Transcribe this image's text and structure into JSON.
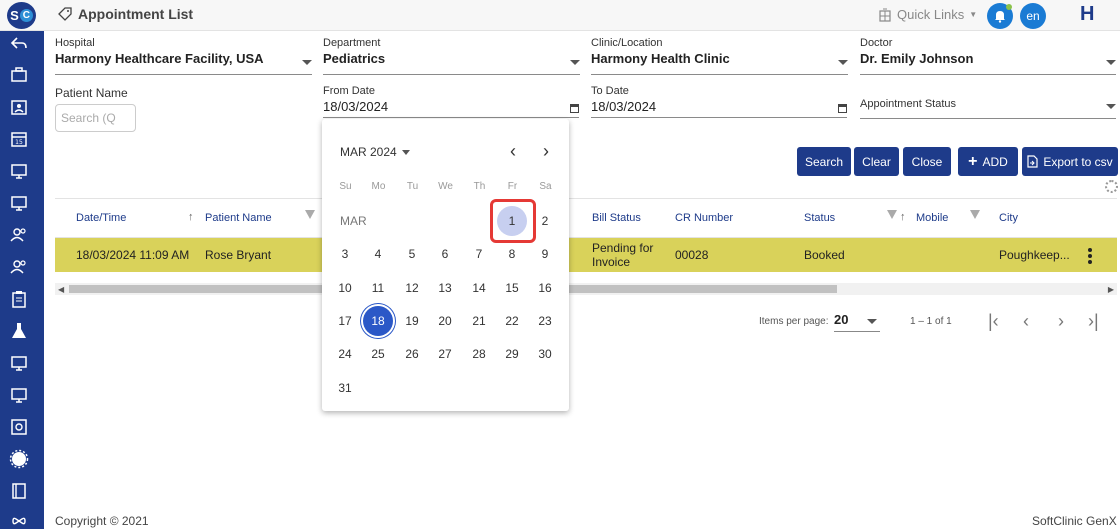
{
  "header": {
    "title": "Appointment List",
    "quick_links": "Quick Links",
    "lang": "en",
    "badge": "H",
    "logo_s": "S",
    "logo_c": "C"
  },
  "sidebar": {
    "icons": [
      "back-arrow-icon",
      "briefcase-icon",
      "id-card-icon",
      "calendar-icon",
      "monitor-icon",
      "monitor-icon",
      "users-icon",
      "users-icon",
      "clipboard-icon",
      "flask-icon",
      "monitor-icon",
      "monitor-icon",
      "safe-icon",
      "badge-icon",
      "book-icon",
      "infinity-icon"
    ]
  },
  "filters": {
    "hospital": {
      "label": "Hospital",
      "value": "Harmony Healthcare Facility, USA"
    },
    "department": {
      "label": "Department",
      "value": "Pediatrics"
    },
    "clinic": {
      "label": "Clinic/Location",
      "value": "Harmony Health Clinic"
    },
    "doctor": {
      "label": "Doctor",
      "value": "Dr. Emily Johnson"
    },
    "patient_name": {
      "label": "Patient Name",
      "placeholder": "Search (Q"
    },
    "from_date": {
      "label": "From Date",
      "value": "18/03/2024"
    },
    "to_date": {
      "label": "To Date",
      "value": "18/03/2024"
    },
    "appointment_status": {
      "label": "Appointment Status"
    }
  },
  "buttons": {
    "search": "Search",
    "clear": "Clear",
    "close": "Close",
    "add": "ADD",
    "export": "Export to csv"
  },
  "table": {
    "columns": [
      "Date/Time",
      "Patient Name",
      "Bill Status",
      "CR Number",
      "Status",
      "Mobile",
      "City"
    ],
    "rows": [
      {
        "datetime": "18/03/2024 11:09 AM",
        "patient": "Rose Bryant",
        "bill_line1": "Pending for",
        "bill_line2": "Invoice",
        "cr": "00028",
        "status": "Booked",
        "mobile": "",
        "city": "Poughkeep..."
      }
    ]
  },
  "paginator": {
    "label": "Items per page:",
    "size": "20",
    "range": "1 – 1 of 1"
  },
  "calendar": {
    "month_year": "MAR 2024",
    "month_short": "MAR",
    "weekdays": [
      "Su",
      "Mo",
      "Tu",
      "We",
      "Th",
      "Fr",
      "Sa"
    ],
    "today": 18,
    "hovered": 1
  },
  "footer": {
    "copyright": "Copyright © 2021",
    "product": "SoftClinic GenX"
  },
  "colors": {
    "primary": "#1e3b8a",
    "row_highlight": "#d9d25a",
    "today": "#2b58c7",
    "hover_day": "#c7cff0",
    "annotation": "#e53935"
  }
}
